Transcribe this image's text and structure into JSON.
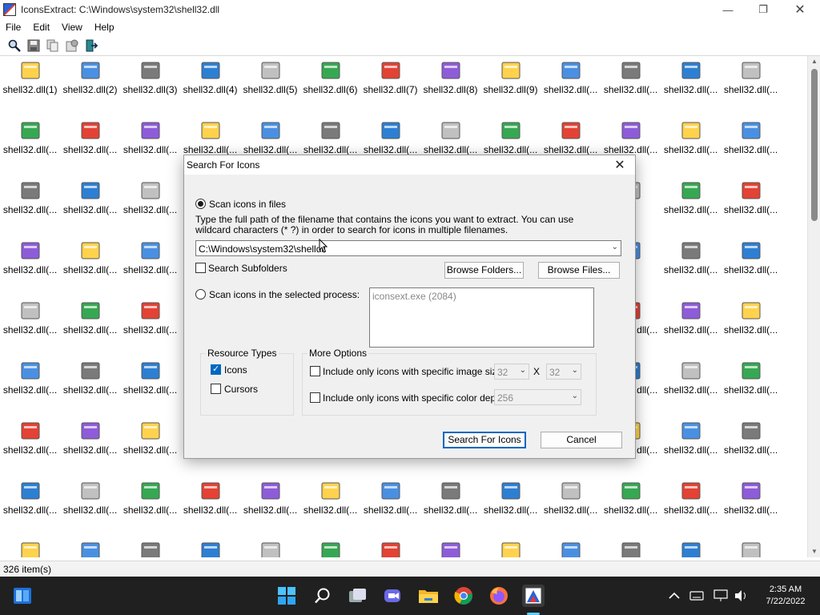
{
  "window": {
    "title": "IconsExtract:   C:\\Windows\\system32\\shell32.dll"
  },
  "menu": [
    "File",
    "Edit",
    "View",
    "Help"
  ],
  "toolbar": [
    "search-icon",
    "save-icon",
    "copy-icon",
    "properties-icon",
    "exit-icon"
  ],
  "grid": {
    "rows": [
      [
        "shell32.dll(1)",
        "shell32.dll(2)",
        "shell32.dll(3)",
        "shell32.dll(4)",
        "shell32.dll(5)",
        "shell32.dll(6)",
        "shell32.dll(7)",
        "shell32.dll(8)",
        "shell32.dll(9)",
        "shell32.dll(...",
        "shell32.dll(...",
        "shell32.dll(...",
        "shell32.dll(..."
      ],
      [
        "shell32.dll(...",
        "shell32.dll(...",
        "shell32.dll(...",
        "shell32.dll(...",
        "shell32.dll(...",
        "shell32.dll(...",
        "shell32.dll(...",
        "shell32.dll(...",
        "shell32.dll(...",
        "shell32.dll(...",
        "shell32.dll(...",
        "shell32.dll(...",
        "shell32.dll(..."
      ],
      [
        "shell32.dll(...",
        "shell32.dll(...",
        "shell32.dll(...",
        "",
        "",
        "",
        "",
        "",
        "",
        "",
        "",
        "shell32.dll(...",
        "shell32.dll(..."
      ],
      [
        "shell32.dll(...",
        "shell32.dll(...",
        "shell32.dll(...",
        "",
        "",
        "",
        "",
        "",
        "",
        "",
        "",
        "shell32.dll(...",
        "shell32.dll(..."
      ],
      [
        "shell32.dll(...",
        "shell32.dll(...",
        "shell32.dll(...",
        "",
        "",
        "",
        "",
        "",
        "",
        "",
        "shell32.dll(...",
        "shell32.dll(...",
        "shell32.dll(..."
      ],
      [
        "shell32.dll(...",
        "shell32.dll(...",
        "shell32.dll(...",
        "",
        "",
        "",
        "",
        "",
        "",
        "",
        "shell32.dll(...",
        "shell32.dll(...",
        "shell32.dll(..."
      ],
      [
        "shell32.dll(...",
        "shell32.dll(...",
        "shell32.dll(...",
        "",
        "",
        "",
        "",
        "",
        "",
        "",
        "shell32.dll(...",
        "shell32.dll(...",
        "shell32.dll(..."
      ],
      [
        "shell32.dll(...",
        "shell32.dll(...",
        "shell32.dll(...",
        "shell32.dll(...",
        "shell32.dll(...",
        "shell32.dll(...",
        "shell32.dll(...",
        "shell32.dll(...",
        "shell32.dll(...",
        "shell32.dll(...",
        "shell32.dll(...",
        "shell32.dll(...",
        "shell32.dll(..."
      ],
      [
        "",
        "",
        "",
        "",
        "",
        "",
        "",
        "",
        "",
        "",
        "",
        "",
        ""
      ]
    ]
  },
  "status": {
    "count": "326 item(s)"
  },
  "dialog": {
    "title": "Search For Icons",
    "scan_files_label": "Scan icons in files",
    "instructions": "Type the full path of the filename that contains the icons you want to extract. You can use wildcard characters (* ?) in order to search for icons in multiple filenames.",
    "path_value": "C:\\Windows\\system32\\shelldll",
    "search_subfolders": "Search Subfolders",
    "browse_folders": "Browse Folders...",
    "browse_files": "Browse Files...",
    "scan_process_label": "Scan icons in the selected process:",
    "process_item": "iconsext.exe  (2084)",
    "resource_types": "Resource Types",
    "icons_label": "Icons",
    "cursors_label": "Cursors",
    "more_options": "More Options",
    "size_option": "Include only icons with specific image size:",
    "size_w": "32",
    "size_x": "X",
    "size_h": "32",
    "depth_option": "Include only icons with specific color depth:",
    "depth_value": "256",
    "search_button": "Search For Icons",
    "cancel_button": "Cancel"
  },
  "taskbar": {
    "time": "2:35 AM",
    "date": "7/22/2022"
  }
}
